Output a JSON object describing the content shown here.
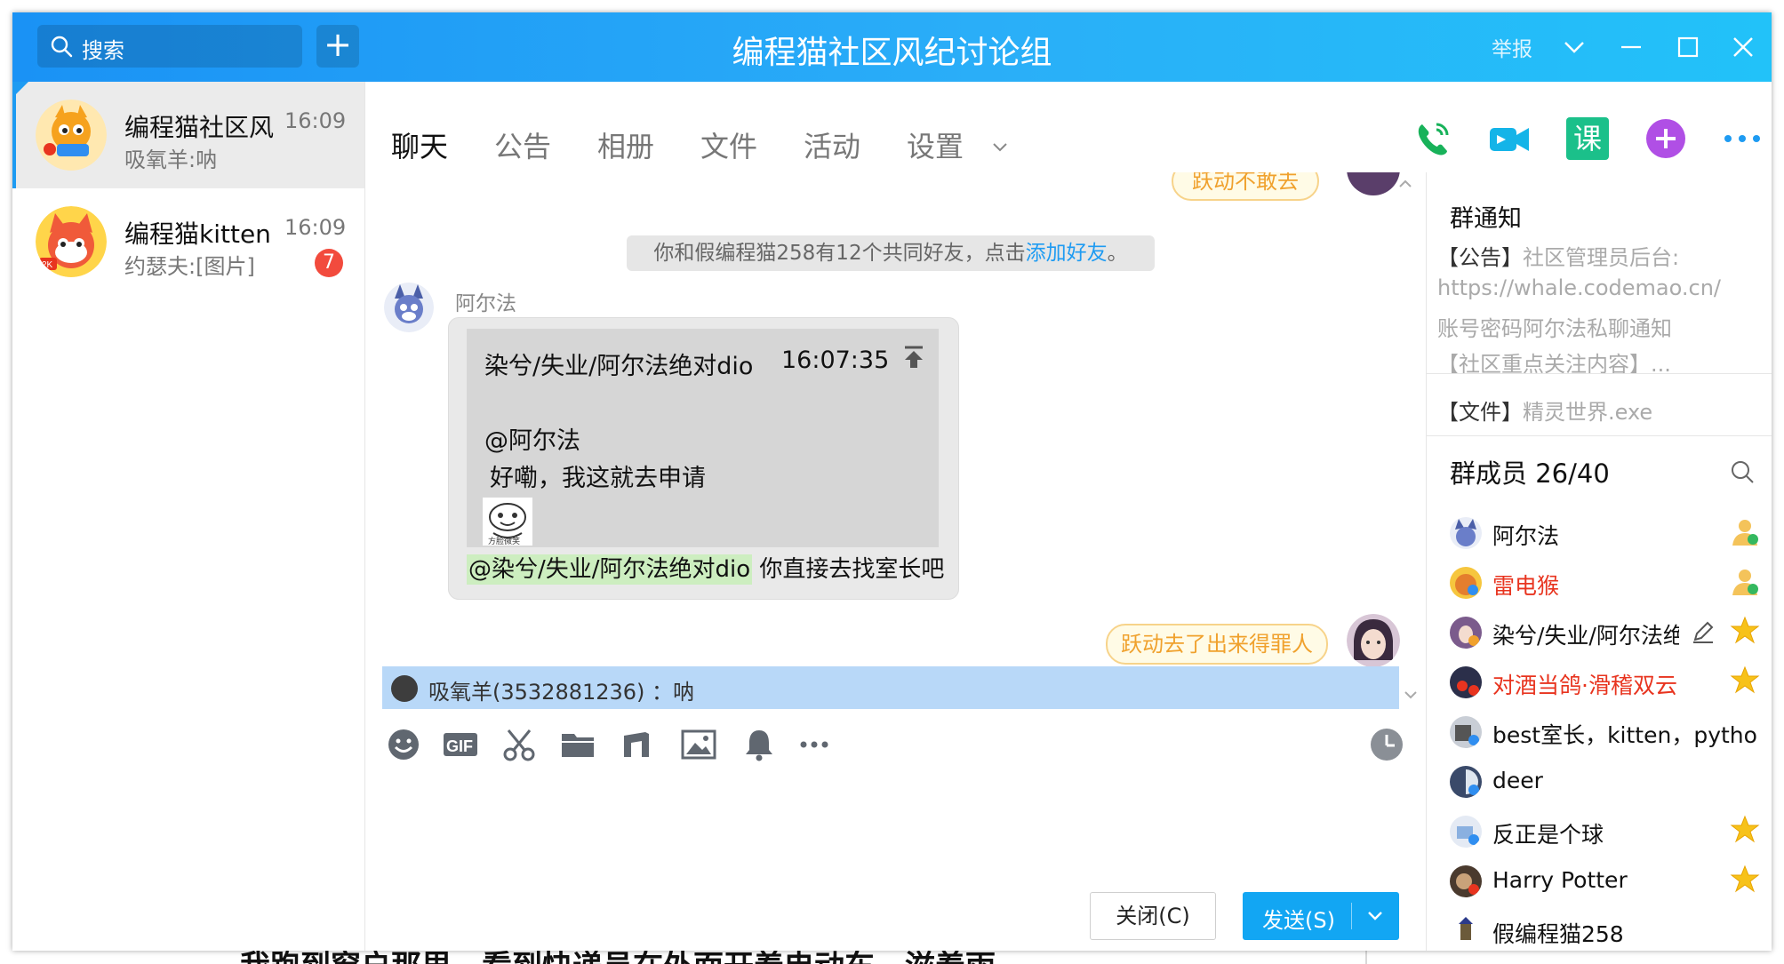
{
  "titlebar": {
    "search_placeholder": "搜索",
    "add_label": "+",
    "group_title": "编程猫社区风纪讨论组",
    "report_label": "举报"
  },
  "conversations": [
    {
      "name": "编程猫社区风纪讨论组",
      "time": "16:09",
      "preview": "吸氧羊:呐",
      "unread": ""
    },
    {
      "name": "编程猫kitten",
      "time": "16:09",
      "preview": "约瑟夫:[图片]",
      "unread": "7"
    }
  ],
  "tabs": [
    {
      "label": "聊天"
    },
    {
      "label": "公告"
    },
    {
      "label": "相册"
    },
    {
      "label": "文件"
    },
    {
      "label": "活动"
    },
    {
      "label": "设置"
    }
  ],
  "toolbar_icons": {
    "call": "phone-icon",
    "video": "video-icon",
    "lesson": "课",
    "add": "plus-icon",
    "more": "more-icon"
  },
  "chat": {
    "top_pill": "跃动不敢去",
    "system_notice_prefix": "你和假编程猫258有12个共同好友，点击",
    "system_notice_link": "添加好友",
    "system_notice_suffix": "。",
    "sender_name": "阿尔法",
    "quote_author": "染兮/失业/阿尔法绝对dio",
    "quote_time": "16:07:35",
    "quote_mention": "@阿尔法",
    "quote_body": "好嘞，我这就去申请",
    "sticker_caption": "方脸微笑",
    "reply_mention": "@染兮/失业/阿尔法绝对dio",
    "reply_text": " 你直接去找室长吧",
    "bottom_pill": "跃动去了出来得罪人"
  },
  "reply_bar": {
    "text": "吸氧羊(3532881236) ：呐"
  },
  "input_tools": [
    "emoji-icon",
    "gif-icon",
    "scissors-icon",
    "folder-icon",
    "music-icon",
    "image-icon",
    "bell-icon",
    "more-icon"
  ],
  "buttons": {
    "close": "关闭(C)",
    "send": "发送(S)"
  },
  "right_panel": {
    "notice_title": "群通知",
    "notice_tag": "【公告】",
    "notice_line1": "社区管理员后台:",
    "notice_line2": "https://whale.codemao.cn/",
    "notice_line3": "账号密码阿尔法私聊通知",
    "notice_line4": "【社区重点关注内容】...",
    "file_tag": "【文件】",
    "file_name": "精灵世界.exe",
    "members_title": "群成员 26/40",
    "members": [
      {
        "name": "阿尔法",
        "red": false,
        "role": "admin"
      },
      {
        "name": "雷电猴",
        "red": true,
        "role": "admin"
      },
      {
        "name": "染兮/失业/阿尔法绝对dio",
        "red": false,
        "role": "star"
      },
      {
        "name": "对酒当鸽·滑稽双云",
        "red": true,
        "role": "star"
      },
      {
        "name": "best室长，kitten，python，",
        "red": false,
        "role": ""
      },
      {
        "name": "deer",
        "red": false,
        "role": ""
      },
      {
        "name": "反正是个球",
        "red": false,
        "role": "star"
      },
      {
        "name": "Harry  Potter",
        "red": false,
        "role": "star"
      },
      {
        "name": "假编程猫258",
        "red": false,
        "role": ""
      }
    ]
  },
  "background": {
    "partial_text": "我跑到窗户那里，看到快递员在外面开着电动车，滋着雨"
  },
  "colors": {
    "titlebar_start": "#1a92f5",
    "titlebar_end": "#22c2f9",
    "accent": "#12a6f3",
    "badge": "#f24b3d",
    "red_name": "#e8341f",
    "reply_bar": "#b8d8f8"
  }
}
